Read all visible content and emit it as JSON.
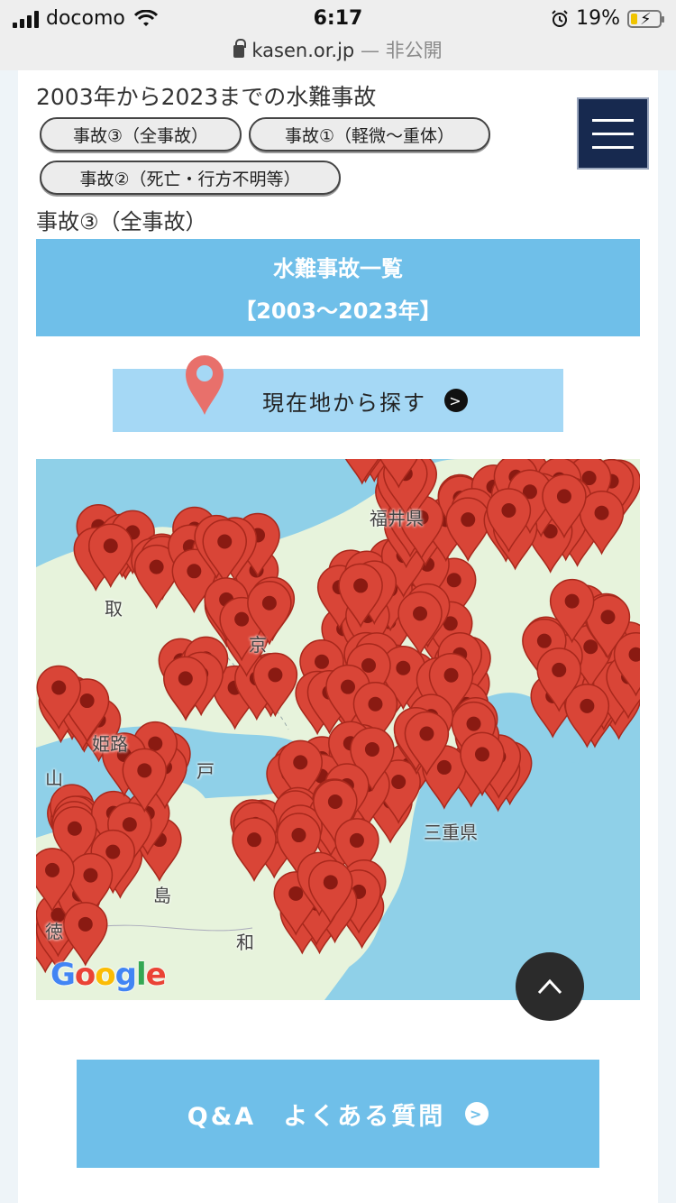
{
  "status_bar": {
    "carrier": "docomo",
    "time": "6:17",
    "battery": "19%",
    "battery_level": 0.19,
    "url": "kasen.or.jp",
    "privacy": "— 非公開"
  },
  "page": {
    "heading": "2003年から2023までの水難事故",
    "filters": [
      {
        "label": "事故③（全事故）"
      },
      {
        "label": "事故①（軽微〜重体）"
      },
      {
        "label": "事故②（死亡・行方不明等）"
      }
    ],
    "section_label": "事故③（全事故）",
    "banner": {
      "line1": "水難事故一覧",
      "line2": "【2003〜2023年】"
    },
    "locate_button": "現在地から探す",
    "qa_button": "Q&A　よくある質問"
  },
  "map": {
    "labels": {
      "fukui": "福井県",
      "tottori": "取",
      "himeji": "姫路",
      "okayama": "山",
      "kobe": "戸",
      "mie": "三重県",
      "tokushima": "徳",
      "shima": "島",
      "wakayama": "和",
      "kyoto": "京"
    },
    "provider": {
      "g1": "G",
      "o1": "o",
      "o2": "o",
      "g2": "g",
      "l": "l",
      "e": "e"
    }
  },
  "colors": {
    "accent_blue": "#6fbfe9",
    "light_blue": "#a5d8f5",
    "navy": "#17294f",
    "pin_red": "#d94537",
    "water": "#8fd0e8",
    "land": "#e7f3dc"
  },
  "icons": {
    "menu": "hamburger-icon",
    "pin": "map-pin-icon",
    "arrow": "chevron-right-icon",
    "scroll_top": "chevron-up-icon"
  }
}
